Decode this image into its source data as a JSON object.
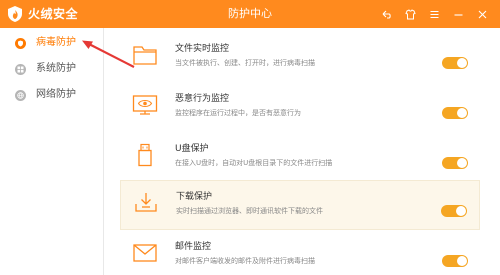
{
  "app": {
    "logo_text": "火绒安全",
    "window_title": "防护中心"
  },
  "window_controls": [
    {
      "name": "back-icon"
    },
    {
      "name": "skin-icon"
    },
    {
      "name": "menu-icon"
    },
    {
      "name": "minimize-icon"
    },
    {
      "name": "close-icon"
    }
  ],
  "sidebar": {
    "items": [
      {
        "label": "病毒防护",
        "icon": "shield-icon",
        "active": true
      },
      {
        "label": "系统防护",
        "icon": "windows-icon",
        "active": false
      },
      {
        "label": "网络防护",
        "icon": "globe-icon",
        "active": false
      }
    ]
  },
  "features": [
    {
      "title": "文件实时监控",
      "desc": "当文件被执行、创建、打开时，进行病毒扫描",
      "icon": "folder-icon",
      "enabled": true
    },
    {
      "title": "恶意行为监控",
      "desc": "监控程序在运行过程中，是否有恶意行为",
      "icon": "monitor-eye-icon",
      "enabled": true
    },
    {
      "title": "U盘保护",
      "desc": "在接入U盘时，自动对U盘根目录下的文件进行扫描",
      "icon": "usb-drive-icon",
      "enabled": true
    },
    {
      "title": "下载保护",
      "desc": "实时扫描通过浏览器、即时通讯软件下载的文件",
      "icon": "download-icon",
      "enabled": true
    },
    {
      "title": "邮件监控",
      "desc": "对邮件客户端收发的邮件及附件进行病毒扫描",
      "icon": "mail-icon",
      "enabled": true
    }
  ],
  "colors": {
    "accent": "#ff8a1e",
    "toggle_on": "#f5a623",
    "annotation": "#e53935"
  }
}
